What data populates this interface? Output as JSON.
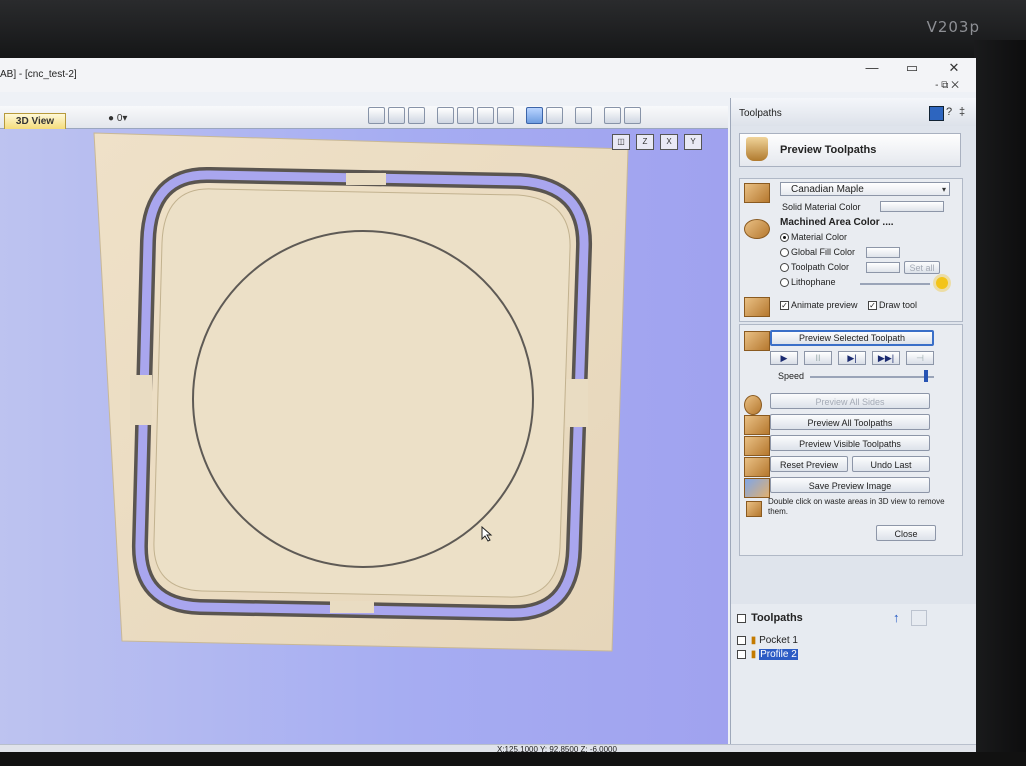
{
  "monitor": {
    "brand": "V203p"
  },
  "window": {
    "title": "AB] - [cnc_test-2]",
    "minimize_glyph": "—",
    "restore_glyph": "▭",
    "close_glyph": "✕",
    "sub_controls": "- ⧉ ✕"
  },
  "view": {
    "tab_label": "3D View",
    "layer_selector": "0▾",
    "axis_icons": [
      "Z",
      "X",
      "Y"
    ]
  },
  "status": {
    "coordinates": "X:125.1000 Y: 92.8500 Z: -6.0000"
  },
  "panel": {
    "title": "Toolpaths",
    "help_glyph": "?",
    "pin_glyph": "‡",
    "preview_header": "Preview Toolpaths",
    "material": {
      "selected": "Canadian Maple",
      "solid_material_label": "Solid Material Color",
      "machined_area_label": "Machined Area Color ....",
      "options": [
        "Material Color",
        "Global Fill Color",
        "Toolpath Color",
        "Lithophane"
      ],
      "selected_option": "Material Color",
      "set_all_label": "Set all",
      "animate_preview_label": "Animate preview",
      "animate_preview_checked": true,
      "draw_tool_label": "Draw tool",
      "draw_tool_checked": true
    },
    "preview": {
      "selected_btn": "Preview Selected Toolpath",
      "media_buttons": [
        "▶",
        "II",
        "▶|",
        "▶▶|",
        "⊣"
      ],
      "speed_label": "Speed",
      "speed_value": 0.92,
      "all_sides_btn": "Preview All Sides",
      "all_toolpaths_btn": "Preview All Toolpaths",
      "visible_toolpaths_btn": "Preview Visible Toolpaths",
      "reset_btn": "Reset Preview",
      "undo_btn": "Undo Last",
      "save_image_btn": "Save Preview Image",
      "hint": "Double click on waste areas in 3D view to remove them.",
      "close_btn": "Close"
    },
    "toolpath_list": {
      "title": "Toolpaths",
      "items": [
        {
          "name": "Pocket 1",
          "selected": false
        },
        {
          "name": "Profile 2",
          "selected": true
        }
      ]
    }
  }
}
